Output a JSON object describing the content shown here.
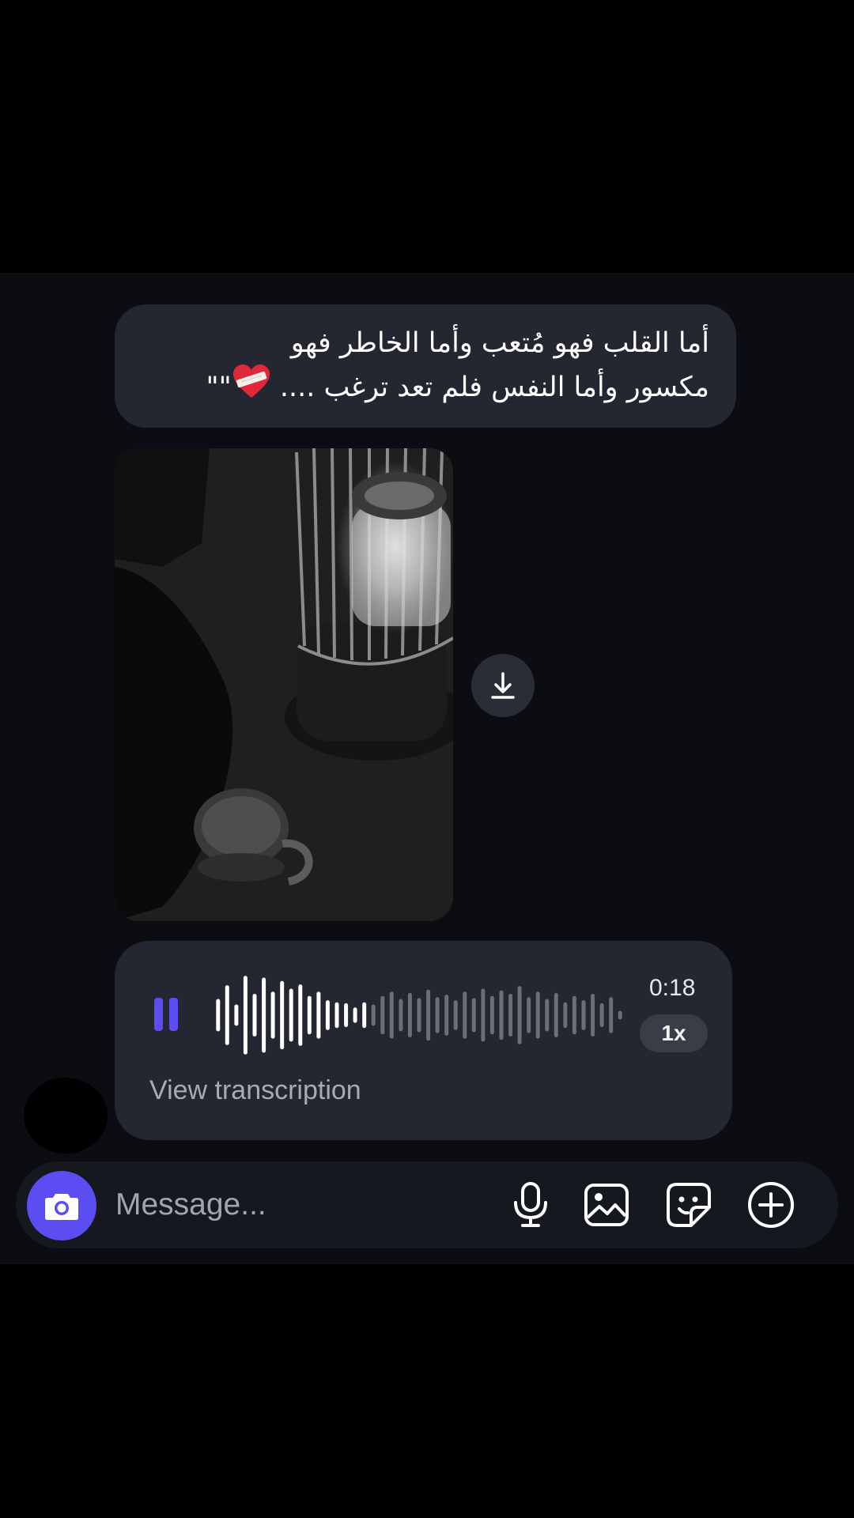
{
  "message": {
    "lines": [
      "أما القلب فهو مُتعب وأما الخاطر فهو",
      "مكسور وأما النفس فلم تعد ترغب ...."
    ],
    "emoji_name": "mending-heart-emoji",
    "closing_quotes": "\"\""
  },
  "photo": {
    "download_icon": "download-icon"
  },
  "voice_message": {
    "status": "playing",
    "pause_icon": "pause-icon",
    "played_fraction": 0.38,
    "waveform_levels": [
      0.38,
      0.7,
      0.25,
      0.92,
      0.5,
      0.88,
      0.55,
      0.8,
      0.62,
      0.72,
      0.45,
      0.55,
      0.35,
      0.3,
      0.28,
      0.18,
      0.3,
      0.25,
      0.45,
      0.55,
      0.38,
      0.52,
      0.4,
      0.6,
      0.42,
      0.48,
      0.35,
      0.55,
      0.4,
      0.62,
      0.45,
      0.58,
      0.5,
      0.68,
      0.42,
      0.55,
      0.38,
      0.52,
      0.3,
      0.45,
      0.35,
      0.5,
      0.28,
      0.42,
      0.1
    ],
    "duration": "0:18",
    "speed": "1x",
    "transcription_label": "View transcription",
    "played_color": "#ffffff",
    "unplayed_color": "#6c6e78",
    "accent_color": "#5b4df2"
  },
  "composer": {
    "placeholder": "Message...",
    "camera_icon": "camera-icon",
    "icons": [
      "microphone-icon",
      "gallery-icon",
      "sticker-icon",
      "add-icon"
    ]
  }
}
